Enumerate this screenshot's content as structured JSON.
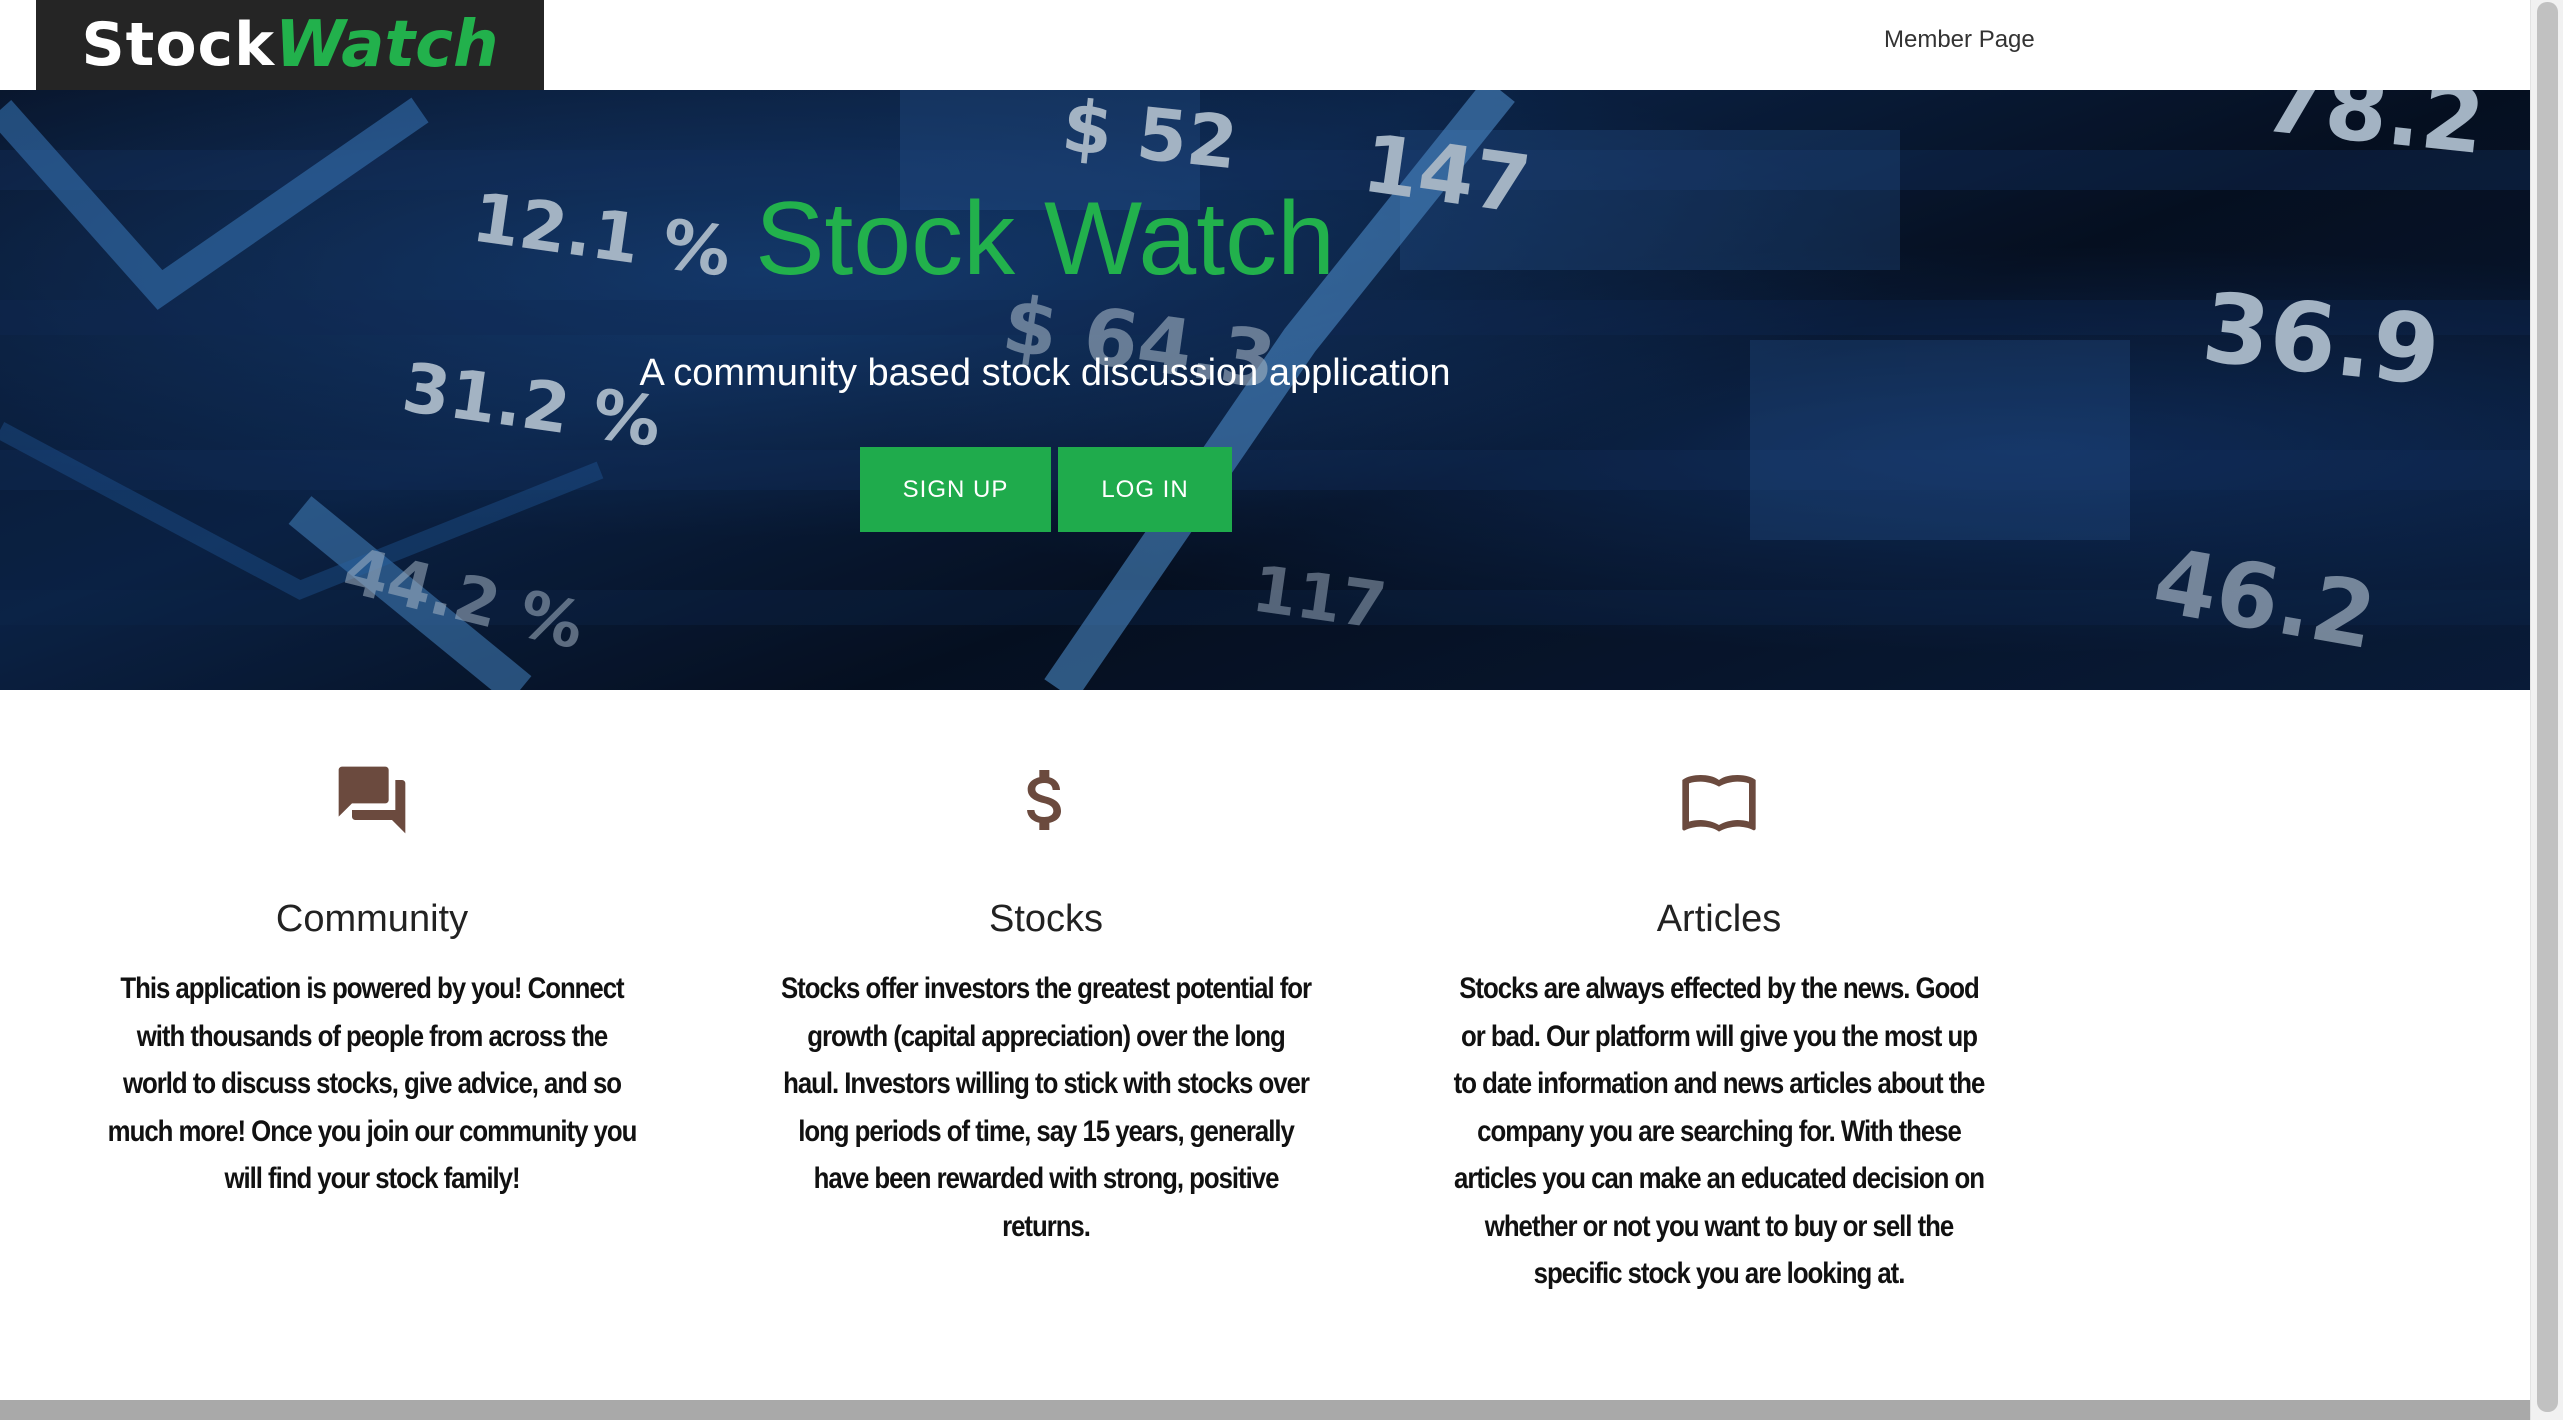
{
  "navbar": {
    "logo_part1": "Stock",
    "logo_part2": "Watch",
    "member_link": "Member Page"
  },
  "hero": {
    "title": "Stock Watch",
    "subtitle": "A community based stock discussion application",
    "signup_label": "SIGN UP",
    "login_label": "LOG IN",
    "background_numbers": [
      "12.1 %",
      "$ 52",
      "147",
      "78.2",
      "$ 64.3",
      "31.2 %",
      "36.9",
      "44.2 %",
      "117",
      "46.2"
    ]
  },
  "features": [
    {
      "icon": "forum-icon",
      "title": "Community",
      "text": "This application is powered by you! Connect with thousands of people from across the world to discuss stocks, give advice, and so much more! Once you join our community you will find your stock family!"
    },
    {
      "icon": "dollar-icon",
      "title": "Stocks",
      "text": "Stocks offer investors the greatest potential for growth (capital appreciation) over the long haul. Investors willing to stick with stocks over long periods of time, say 15 years, generally have been rewarded with strong, positive returns."
    },
    {
      "icon": "book-icon",
      "title": "Articles",
      "text": "Stocks are always effected by the news. Good or bad. Our platform will give you the most up to date information and news articles about the company you are searching for. With these articles you can make an educated decision on whether or not you want to buy or sell the specific stock you are looking at."
    }
  ],
  "colors": {
    "brand_green": "#22b14c",
    "button_green": "#1fab4c",
    "logo_bg": "#252525",
    "icon_brown": "#6b4a3e"
  }
}
